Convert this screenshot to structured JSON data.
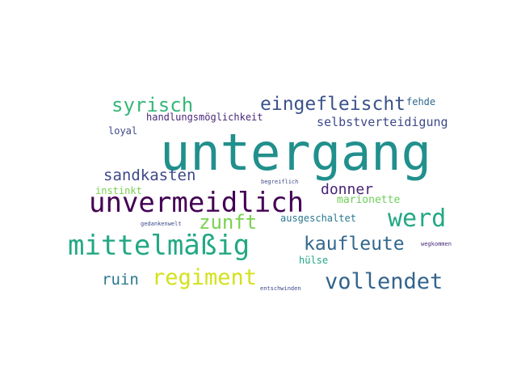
{
  "words": [
    {
      "text": "untergang",
      "color": "#21908d"
    },
    {
      "text": "unvermeidlich",
      "color": "#440154"
    },
    {
      "text": "mittelmäßig",
      "color": "#22a884"
    },
    {
      "text": "vollendet",
      "color": "#33638d"
    },
    {
      "text": "werd",
      "color": "#22a884"
    },
    {
      "text": "regiment",
      "color": "#d2e21b"
    },
    {
      "text": "kaufleute",
      "color": "#31688e"
    },
    {
      "text": "eingefleischt",
      "color": "#3b528b"
    },
    {
      "text": "syrisch",
      "color": "#35b779"
    },
    {
      "text": "zunft",
      "color": "#7ad151"
    },
    {
      "text": "sandkasten",
      "color": "#3e4989"
    },
    {
      "text": "ruin",
      "color": "#2a788e"
    },
    {
      "text": "donner",
      "color": "#482475"
    },
    {
      "text": "selbstverteidigung",
      "color": "#3e4989"
    },
    {
      "text": "handlungsmöglichkeit",
      "color": "#482878"
    },
    {
      "text": "marionette",
      "color": "#6ece58"
    },
    {
      "text": "ausgeschaltet",
      "color": "#2a788e"
    },
    {
      "text": "hülse",
      "color": "#22a884"
    },
    {
      "text": "instinkt",
      "color": "#7ad151"
    },
    {
      "text": "loyal",
      "color": "#3e4989"
    },
    {
      "text": "fehde",
      "color": "#31688e"
    },
    {
      "text": "begreiflich",
      "color": "#3e4989"
    },
    {
      "text": "gedankenwelt",
      "color": "#3e4989"
    },
    {
      "text": "wegkommen",
      "color": "#482878"
    },
    {
      "text": "entschwinden",
      "color": "#3e4989"
    }
  ]
}
